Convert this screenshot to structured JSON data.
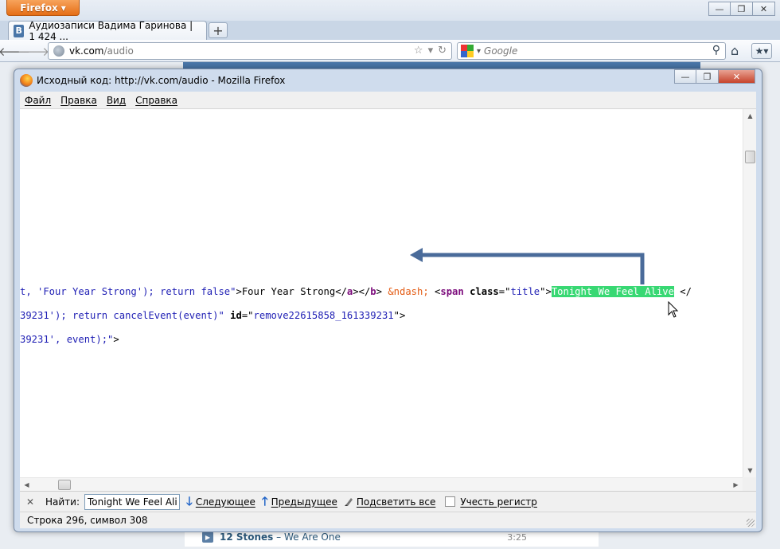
{
  "browser": {
    "app_button": "Firefox",
    "tab_title": "Аудиозаписи Вадима Гаринова | 1 424 ...",
    "tab_favicon": "В",
    "url_host": "vk.com",
    "url_path": "/audio",
    "search_placeholder": "Google"
  },
  "background_page": {
    "song_artist": "12 Stones",
    "song_separator": " – ",
    "song_title": "We Are One",
    "song_duration": "3:25"
  },
  "source_window": {
    "title": "Исходный код: http://vk.com/audio - Mozilla Firefox",
    "menu": [
      "Файл",
      "Правка",
      "Вид",
      "Справка"
    ],
    "code_lines": [
      {
        "parts": [
          {
            "text": "t, 'Four Year Strong'); return false\"",
            "style": "blue"
          },
          {
            "text": ">Four Year Strong</",
            "style": "black"
          },
          {
            "text": "a",
            "style": "purple"
          },
          {
            "text": "></",
            "style": "black"
          },
          {
            "text": "b",
            "style": "purple"
          },
          {
            "text": "> ",
            "style": "black"
          },
          {
            "text": "&ndash;",
            "style": "orange"
          },
          {
            "text": " <",
            "style": "black"
          },
          {
            "text": "span",
            "style": "purple"
          },
          {
            "text": " class",
            "style": "bold"
          },
          {
            "text": "=\"",
            "style": "black"
          },
          {
            "text": "title",
            "style": "blue"
          },
          {
            "text": "\">",
            "style": "black"
          },
          {
            "text": "Tonight We Feel Alive",
            "style": "highlight"
          },
          {
            "text": " </",
            "style": "black"
          }
        ]
      },
      {
        "parts": [
          {
            "text": "39231'); return cancelEvent(event)\"",
            "style": "blue"
          },
          {
            "text": " id",
            "style": "bold"
          },
          {
            "text": "=\"",
            "style": "black"
          },
          {
            "text": "remove22615858_161339231",
            "style": "blue"
          },
          {
            "text": "\">",
            "style": "black"
          }
        ]
      },
      {
        "parts": [
          {
            "text": "39231', event);\"",
            "style": "blue"
          },
          {
            "text": ">",
            "style": "black"
          }
        ]
      }
    ],
    "find_bar": {
      "label": "Найти:",
      "value": "Tonight We Feel Alive",
      "next": "Следующее",
      "previous": "Предыдущее",
      "highlight_all": "Подсветить все",
      "match_case": "Учесть регистр"
    },
    "status": "Строка 296, символ 308"
  },
  "colors": {
    "highlight": "#38d873",
    "arrow": "#4a6b9a",
    "vk_blue": "#4a76a8"
  }
}
